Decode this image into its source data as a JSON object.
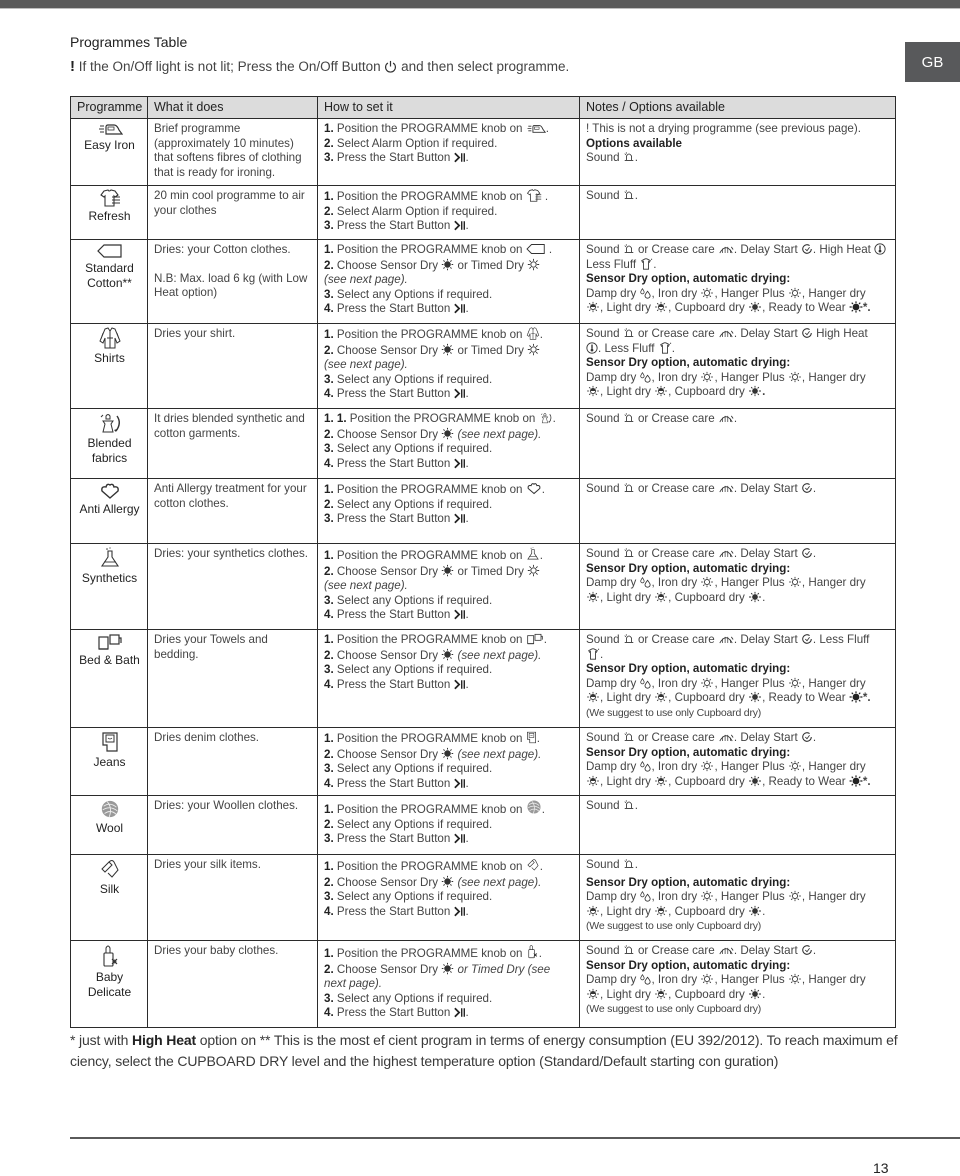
{
  "page": {
    "side_tab": "GB",
    "title": "Programmes Table",
    "notice_mark": "!",
    "notice_before_icon": " If the On/Off light is not lit; Press the On/Off Button ",
    "notice_after_icon": " and then select programme.",
    "page_number": "13"
  },
  "table": {
    "headers": [
      "Programme",
      "What it does",
      "How to set it",
      "Notes / Options available"
    ],
    "rows": [
      {
        "programme": "Easy Iron",
        "icon": "iron-icon",
        "what": "Brief programme (approximately 10 minutes) that softens fibres of clothing that is ready for ironing.",
        "steps": [
          {
            "n": "1.",
            "text": " Position the PROGRAMME knob on ",
            "icon": "iron-icon",
            "tail": "."
          },
          {
            "n": "2.",
            "text": " Select Alarm Option if required."
          },
          {
            "n": "3.",
            "text": " Press the Start Button ",
            "icon": "start-pause-icon",
            "tail": "."
          }
        ],
        "notes": {
          "warning": "! This is not a drying programme (see previous page).",
          "options_heading": "Options available",
          "options": "Sound",
          "options_icons": [
            "bell-icon"
          ]
        }
      },
      {
        "programme": "Refresh",
        "icon": "refresh-shirt-icon",
        "what": "20 min cool programme to air your clothes",
        "steps": [
          {
            "n": "1.",
            "text": " Position the PROGRAMME knob on ",
            "icon": "refresh-shirt-icon",
            "tail": " ."
          },
          {
            "n": "2.",
            "text": " Select Alarm Option if required."
          },
          {
            "n": "3.",
            "text": " Press the Start Button ",
            "icon": "start-pause-icon",
            "tail": "."
          }
        ],
        "notes": {
          "options": "Sound"
        }
      },
      {
        "programme": "Standard Cotton**",
        "icon": "cotton-tag-icon",
        "what": "Dries: your Cotton clothes.",
        "what_note": "N.B: Max. load 6 kg (with Low Heat option)",
        "steps": [
          {
            "n": "1.",
            "text": " Position the PROGRAMME knob on ",
            "icon": "cotton-tag-icon",
            "tail": " ."
          },
          {
            "n": "2.",
            "text": " Choose Sensor Dry ",
            "icon": "sensor-dry-icon",
            "text2": " or Timed Dry ",
            "icon2": "timed-dry-icon"
          },
          {
            "italic": "(see next page)."
          },
          {
            "n": "3.",
            "text": " Select any Options if required."
          },
          {
            "n": "4.",
            "text": " Press the Start Button ",
            "icon": "start-pause-icon",
            "tail": "."
          }
        ],
        "notes": {
          "options_line": "Sound [bell] or Crease care [crease]. Delay Start [delay].  High Heat [thermo] Less Fluff [fluff].",
          "sensor_heading": "Sensor Dry option, automatic drying:",
          "sensor_levels": "Damp dry, Iron dry, Hanger Plus, Hanger dry, Light dry, Cupboard dry, Ready to Wear*."
        }
      },
      {
        "programme": "Shirts",
        "icon": "shirt-icon",
        "what": "Dries your shirt.",
        "steps": [
          {
            "n": "1.",
            "text": " Position the PROGRAMME knob on ",
            "icon": "shirt-icon",
            "tail": "."
          },
          {
            "n": "2.",
            "text": " Choose Sensor Dry ",
            "icon": "sensor-dry-icon",
            "text2": " or Timed Dry ",
            "icon2": "timed-dry-icon"
          },
          {
            "italic": "(see next page)."
          },
          {
            "n": "3.",
            "text": " Select any Options if required."
          },
          {
            "n": "4.",
            "text": " Press the Start Button ",
            "icon": "start-pause-icon",
            "tail": "."
          }
        ],
        "notes": {
          "options_line": "Sound or Crease care. Delay Start.  High Heat. Less Fluff.",
          "sensor_heading": "Sensor Dry option, automatic drying:",
          "sensor_levels": "Damp dry, Iron dry, Hanger Plus, Hanger dry, Light dry, Cupboard dry."
        }
      },
      {
        "programme": "Blended fabrics",
        "icon": "blended-fabrics-icon",
        "what": "It dries blended synthetic and cotton garments.",
        "steps": [
          {
            "n": "1. 1.",
            "text": " Position the PROGRAMME knob on ",
            "icon": "blended-fabrics-icon",
            "tail": "."
          },
          {
            "n": "2.",
            "text": " Choose Sensor Dry ",
            "icon": "sensor-dry-icon",
            "italic_tail": "  (see next page)."
          },
          {
            "n": "3.",
            "text": " Select any Options if required."
          },
          {
            "n": "4.",
            "text": " Press the Start Button ",
            "icon": "start-pause-icon",
            "tail": "."
          }
        ],
        "notes": {
          "options_line": "Sound or Crease care."
        }
      },
      {
        "programme": "Anti Allergy",
        "icon": "anti-allergy-icon",
        "what": "Anti Allergy treatment for your cotton clothes.",
        "steps": [
          {
            "n": "1.",
            "text": " Position the PROGRAMME knob on ",
            "icon": "anti-allergy-icon",
            "tail": "."
          },
          {
            "n": "2.",
            "text": " Select any Options if required."
          },
          {
            "n": "3.",
            "text": " Press the Start Button ",
            "icon": "start-pause-icon",
            "tail": "."
          }
        ],
        "notes": {
          "options_line": "Sound or Crease care. Delay Start."
        }
      },
      {
        "programme": "Synthetics",
        "icon": "synthetics-flask-icon",
        "what": "Dries: your synthetics clothes.",
        "steps": [
          {
            "n": "1.",
            "text": " Position the PROGRAMME knob on ",
            "icon": "synthetics-flask-icon",
            "tail": "."
          },
          {
            "n": "2.",
            "text": " Choose Sensor Dry ",
            "icon": "sensor-dry-icon",
            "text2": " or Timed Dry ",
            "icon2": "timed-dry-icon"
          },
          {
            "italic": "(see next page)."
          },
          {
            "n": "3.",
            "text": " Select any Options if required."
          },
          {
            "n": "4.",
            "text": " Press the Start Button ",
            "icon": "start-pause-icon",
            "tail": "."
          }
        ],
        "notes": {
          "options_line": "Sound or Crease care. Delay Start.",
          "sensor_heading": "Sensor Dry option, automatic drying:",
          "sensor_levels": "Damp dry, Iron dry, Hanger Plus, Hanger dry, Light dry, Cupboard dry."
        }
      },
      {
        "programme": "Bed & Bath",
        "icon": "towels-icon",
        "what": "Dries your Towels and bedding.",
        "steps": [
          {
            "n": "1.",
            "text": " Position the PROGRAMME knob on ",
            "icon": "towels-icon",
            "tail": "."
          },
          {
            "n": "2.",
            "text": " Choose Sensor Dry ",
            "icon": "sensor-dry-icon",
            "italic_tail": " (see next page)."
          },
          {
            "n": "3.",
            "text": " Select any Options if required."
          },
          {
            "n": "4.",
            "text": " Press the Start Button ",
            "icon": "start-pause-icon",
            "tail": "."
          }
        ],
        "notes": {
          "options_line": "Sound or Crease care. Delay Start. Less Fluff.",
          "sensor_heading": "Sensor Dry option, automatic drying:",
          "sensor_levels": "Damp dry, Iron dry, Hanger Plus, Hanger dry, Light dry, Cupboard dry, Ready to Wear*.",
          "suggestion": "(We suggest to use only Cupboard dry)"
        }
      },
      {
        "programme": "Jeans",
        "icon": "jeans-icon",
        "what": "Dries denim clothes.",
        "steps": [
          {
            "n": "1.",
            "text": " Position the PROGRAMME knob on ",
            "icon": "jeans-icon",
            "tail": "."
          },
          {
            "n": "2.",
            "text": " Choose Sensor Dry ",
            "icon": "sensor-dry-icon",
            "italic_tail": " (see next page)."
          },
          {
            "n": "3.",
            "text": " Select any Options if required."
          },
          {
            "n": "4.",
            "text": " Press the Start Button ",
            "icon": "start-pause-icon",
            "tail": "."
          }
        ],
        "notes": {
          "options_line": "Sound or Crease care. Delay Start.",
          "sensor_heading": "Sensor Dry option, automatic drying:",
          "sensor_levels": "Damp dry, Iron dry, Hanger Plus, Hanger dry, Light dry, Cupboard dry, Ready to Wear*."
        }
      },
      {
        "programme": "Wool",
        "icon": "wool-ball-icon",
        "what": "Dries: your Woollen clothes.",
        "steps": [
          {
            "n": "1.",
            "text": " Position the PROGRAMME knob on ",
            "icon": "wool-ball-icon",
            "tail": "."
          },
          {
            "n": "2.",
            "text": " Select any Options if required."
          },
          {
            "n": "3.",
            "text": " Press the Start Button ",
            "icon": "start-pause-icon",
            "tail": "."
          }
        ],
        "notes": {
          "options": "Sound"
        }
      },
      {
        "programme": "Silk",
        "icon": "silk-icon",
        "what": "Dries your silk items.",
        "steps": [
          {
            "n": "1.",
            "text": " Position the PROGRAMME knob on ",
            "icon": "silk-icon",
            "tail": "."
          },
          {
            "n": "2.",
            "text": " Choose Sensor Dry ",
            "icon": "sensor-dry-icon",
            "italic_tail": " (see next page)."
          },
          {
            "n": "3.",
            "text": " Select any Options if required."
          },
          {
            "n": "4.",
            "text": " Press the Start Button ",
            "icon": "start-pause-icon",
            "tail": "."
          }
        ],
        "notes": {
          "options": "Sound",
          "sensor_heading": "Sensor Dry option, automatic drying:",
          "sensor_levels": "Damp dry, Iron dry, Hanger Plus, Hanger dry, Light dry, Cupboard dry.",
          "suggestion": "(We suggest to use only Cupboard dry)"
        }
      },
      {
        "programme": "Baby Delicate",
        "icon": "baby-bottle-icon",
        "what": "Dries your baby clothes.",
        "steps": [
          {
            "n": "1.",
            "text": " Position the PROGRAMME knob on ",
            "icon": "baby-bottle-icon",
            "tail": "."
          },
          {
            "n": "2.",
            "text": " Choose Sensor Dry ",
            "icon": "sensor-dry-icon",
            "italic_tail": " or Timed Dry  (see next page)."
          },
          {
            "n": "3.",
            "text": " Select any Options if required."
          },
          {
            "n": "4.",
            "text": " Press the Start Button ",
            "icon": "start-pause-icon",
            "tail": "."
          }
        ],
        "notes": {
          "options_line": "Sound or Crease care. Delay Start.",
          "sensor_heading": "Sensor Dry option, automatic drying:",
          "sensor_levels": "Damp dry, Iron dry, Hanger Plus, Hanger dry, Light dry, Cupboard dry.",
          "suggestion": "(We suggest to use only Cupboard dry)"
        }
      }
    ]
  },
  "labels": {
    "sound": "Sound",
    "or_crease": " or Crease care ",
    "delay_start": ". Delay Start ",
    "high_heat": ".  High Heat ",
    "high_heat_short": "  High Heat",
    "less_fluff": "Less Fluff ",
    "less_fluff_inline": ". Less Fluff ",
    "damp_dry": "Damp dry ",
    "iron_dry": ", Iron dry ",
    "hanger_plus": ", Hanger Plus ",
    "hanger_dry": ", Hanger dry",
    "light_dry": ", Light dry ",
    "cupboard_dry": ", Cupboard dry ",
    "ready_to_wear": ", Ready to Wear ",
    "star": "*",
    "period": ".",
    "comma": ","
  },
  "footnote": {
    "part1": "* just with ",
    "bold": "High Heat",
    "part2": " option on ** This  is the most ef cient program in terms of energy consumption (EU 392/2012). To reach maximum ef ciency, select the CUPBOARD DRY level and the highest temperature option (Standard/Default starting con guration)"
  },
  "colors": {
    "header_bg": "#dcdcdc",
    "side_tab_bg": "#58595b",
    "border": "#2b2b2b"
  }
}
